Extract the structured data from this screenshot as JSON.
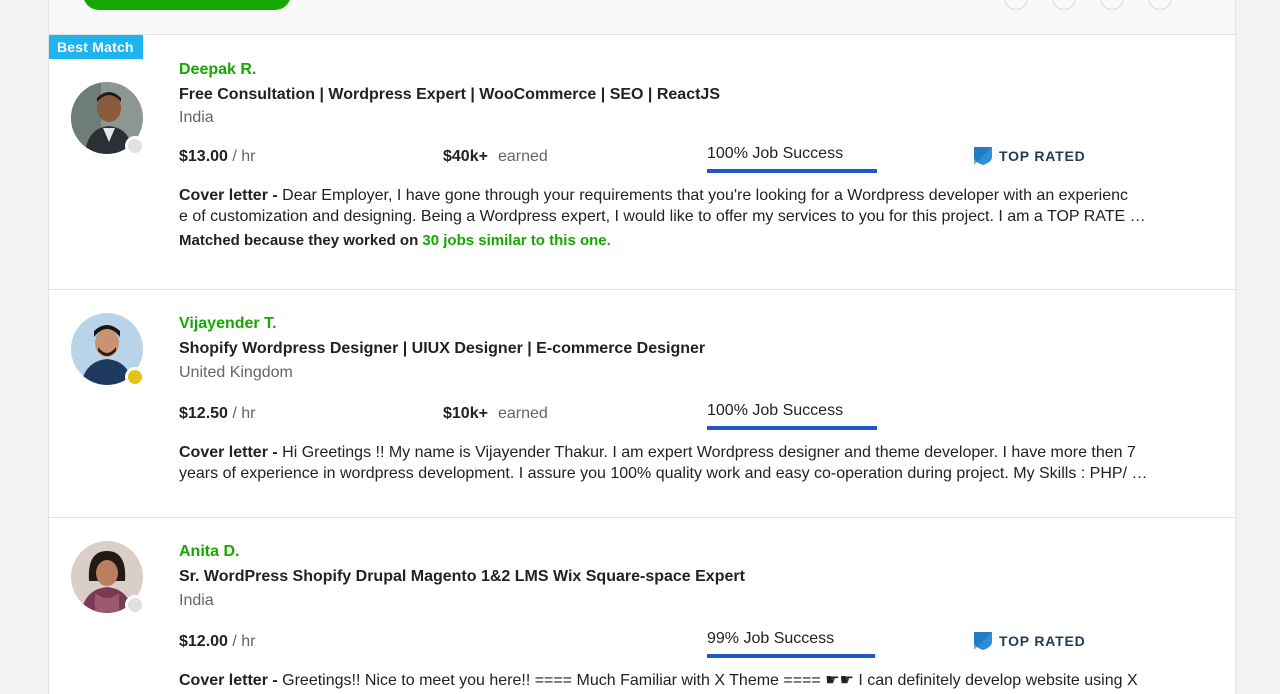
{
  "badge": "Best Match",
  "cover_label": "Cover letter",
  "cards": [
    {
      "name": "Deepak R.",
      "headline": "Free Consultation | Wordpress Expert | WooCommerce | SEO | ReactJS",
      "location": "India",
      "rate": "$13.00",
      "rate_unit": "/ hr",
      "earned": "$40k+",
      "earned_label": "earned",
      "job_success": "100% Job Success",
      "job_success_value": 100,
      "top_rated": "TOP RATED",
      "status_color": "#e0e0e0",
      "cover_line1": "Dear Employer, I have gone through your requirements that you're looking for a Wordpress developer with an experienc",
      "cover_line2": "e of customization and designing. Being a Wordpress expert, I would like to offer my services to you for this project. I am a TOP RATE …",
      "matched_prefix": "Matched because they worked on",
      "matched_link": "30 jobs similar to this one."
    },
    {
      "name": "Vijayender T.",
      "headline": "Shopify Wordpress Designer | UIUX Designer | E-commerce Designer",
      "location": "United Kingdom",
      "rate": "$12.50",
      "rate_unit": "/ hr",
      "earned": "$10k+",
      "earned_label": "earned",
      "job_success": "100% Job Success",
      "job_success_value": 100,
      "status_color": "#e3c21b",
      "cover_line1": "Hi Greetings !! My name is Vijayender Thakur. I am expert Wordpress designer and theme developer. I have more then 7",
      "cover_line2": "years of experience in wordpress development. I assure you 100% quality work and easy co-operation during project. My Skills : PHP/ …"
    },
    {
      "name": "Anita D.",
      "headline": "Sr. WordPress Shopify Drupal Magento 1&2 LMS Wix Square-space Expert",
      "location": "India",
      "rate": "$12.00",
      "rate_unit": "/ hr",
      "job_success": "99% Job Success",
      "job_success_value": 99,
      "top_rated": "TOP RATED",
      "status_color": "#e0e0e0",
      "cover_line1": "Greetings!! Nice to meet you here!! ==== Much Familiar with X Theme ==== ☛☛ I can definitely develop website using X"
    }
  ],
  "colors": {
    "accent_green": "#14a800",
    "badge_blue": "#1fb3f0",
    "jss_blue": "#1f57c3",
    "top_rated_blue": "#1c3d54"
  }
}
